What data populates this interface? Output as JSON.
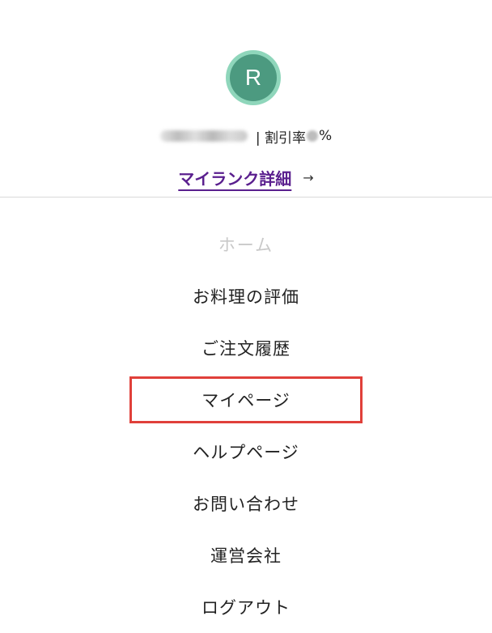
{
  "profile": {
    "avatar_initial": "R",
    "rate_prefix": "| 割引率",
    "rate_suffix": "%",
    "rank_link_label": "マイランク詳細",
    "rank_link_arrow": "→",
    "colors": {
      "avatar_ring": "#8fd6bb",
      "avatar_fill": "#4c9a80",
      "link": "#5a1f8e"
    }
  },
  "menu": {
    "items": [
      {
        "label": "ホーム"
      },
      {
        "label": "お料理の評価"
      },
      {
        "label": "ご注文履歴"
      },
      {
        "label": "マイページ"
      },
      {
        "label": "ヘルプページ"
      },
      {
        "label": "お問い合わせ"
      },
      {
        "label": "運営会社"
      },
      {
        "label": "ログアウト"
      }
    ],
    "highlight_color": "#e0403a"
  }
}
